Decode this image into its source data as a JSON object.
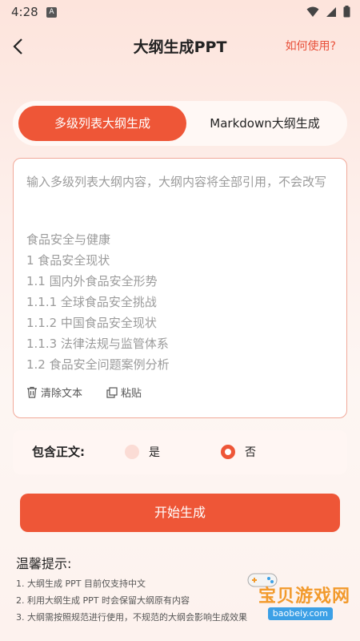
{
  "status_bar": {
    "time": "4:28",
    "notification_icon": "A"
  },
  "header": {
    "title": "大纲生成PPT",
    "help_link": "如何使用?"
  },
  "tabs": [
    {
      "label": "多级列表大纲生成",
      "active": true
    },
    {
      "label": "Markdown大纲生成",
      "active": false
    }
  ],
  "editor": {
    "placeholder": "输入多级列表大纲内容，大纲内容将全部引用，不会改写",
    "outline": [
      "食品安全与健康",
      "1 食品安全现状",
      "1.1 国内外食品安全形势",
      "1.1.1 全球食品安全挑战",
      "1.1.2 中国食品安全现状",
      "1.1.3 法律法规与监管体系",
      "1.2 食品安全问题案例分析"
    ],
    "clear_label": "清除文本",
    "paste_label": "粘贴"
  },
  "content_option": {
    "label": "包含正文:",
    "yes_label": "是",
    "no_label": "否",
    "selected": "否"
  },
  "start_button": "开始生成",
  "tips": {
    "title": "温馨提示:",
    "items": [
      "1. 大纲生成 PPT 目前仅支持中文",
      "2. 利用大纲生成 PPT 时会保留大纲原有内容",
      "3. 大纲需按照规范进行使用，不规范的大纲会影响生成效果"
    ]
  },
  "watermark": {
    "text": "宝贝游戏网",
    "domain": "baobeiy.com"
  },
  "colors": {
    "accent": "#ee5637",
    "border": "#f1a99a",
    "background": "#fdeee9"
  }
}
